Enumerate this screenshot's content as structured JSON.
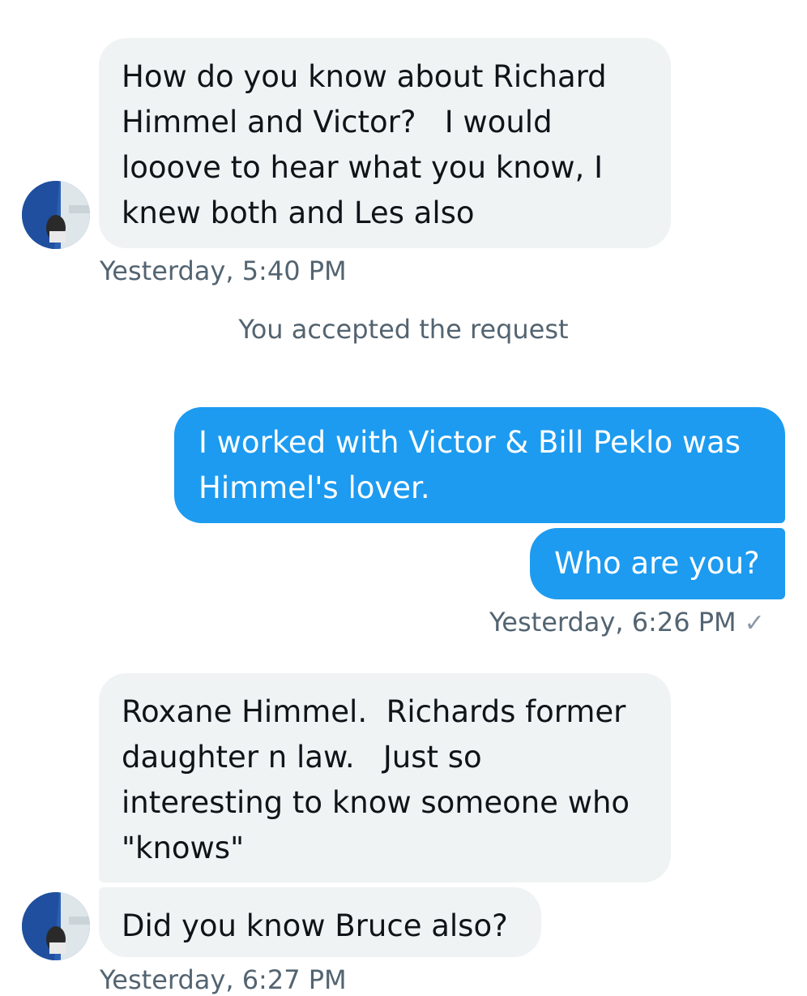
{
  "messages": [
    {
      "text": "How do you know about Richard\nHimmel and Victor?   I would\nlooove to hear what you know, I\nknew both and Les also",
      "direction": "received"
    },
    {
      "text": "I worked with Victor & Bill Peklo was\nHimmel's lover.",
      "direction": "sent"
    },
    {
      "text": "Who are you?",
      "direction": "sent"
    },
    {
      "text": "Roxane Himmel.  Richards former\ndaughter n law.   Just so\ninteresting to know someone who\n\"knows\"",
      "direction": "received"
    },
    {
      "text": "Did you know Bruce also?",
      "direction": "received"
    }
  ],
  "timestamps": {
    "first": "Yesterday, 5:40 PM",
    "second": "Yesterday, 6:26 PM",
    "third": "Yesterday, 6:27 PM"
  },
  "system_note": "You accepted the request",
  "read_receipt_icon": "check-icon",
  "colors": {
    "sent_bubble": "#1d9bf0",
    "received_bubble": "#eff3f4",
    "meta_text": "#536471"
  }
}
